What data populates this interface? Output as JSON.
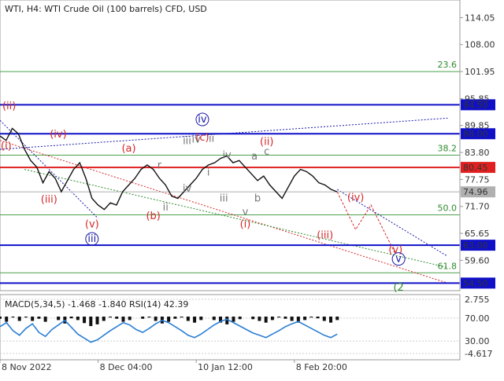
{
  "chart_data": {
    "type": "line",
    "title": "WTI, H4:  WTI Crude Oil (100 barrels) CFD, USD",
    "price_axis": {
      "ticks": [
        114.05,
        108.0,
        101.95,
        95.85,
        89.85,
        83.8,
        77.75,
        71.7,
        65.65,
        59.6
      ],
      "ylim": [
        52.8,
        118.0
      ]
    },
    "time_axis": {
      "labels": [
        "8 Nov 2022",
        "8 Dec 04:00",
        "10 Jan 12:00",
        "8 Feb 20:00"
      ],
      "xlim": [
        0,
        150
      ]
    },
    "price_series": [
      {
        "x": 0,
        "y": 87.5
      },
      {
        "x": 2,
        "y": 86.5
      },
      {
        "x": 4,
        "y": 89.2
      },
      {
        "x": 6,
        "y": 88.0
      },
      {
        "x": 8,
        "y": 84.5
      },
      {
        "x": 10,
        "y": 82.0
      },
      {
        "x": 12,
        "y": 80.5
      },
      {
        "x": 14,
        "y": 77.0
      },
      {
        "x": 16,
        "y": 79.5
      },
      {
        "x": 18,
        "y": 78.0
      },
      {
        "x": 20,
        "y": 75.0
      },
      {
        "x": 22,
        "y": 77.5
      },
      {
        "x": 24,
        "y": 80.0
      },
      {
        "x": 26,
        "y": 81.5
      },
      {
        "x": 28,
        "y": 78.0
      },
      {
        "x": 30,
        "y": 73.5
      },
      {
        "x": 32,
        "y": 72.0
      },
      {
        "x": 34,
        "y": 71.0
      },
      {
        "x": 36,
        "y": 72.5
      },
      {
        "x": 38,
        "y": 72.0
      },
      {
        "x": 40,
        "y": 75.0
      },
      {
        "x": 42,
        "y": 76.5
      },
      {
        "x": 44,
        "y": 78.0
      },
      {
        "x": 46,
        "y": 80.0
      },
      {
        "x": 48,
        "y": 81.0
      },
      {
        "x": 50,
        "y": 80.0
      },
      {
        "x": 52,
        "y": 78.0
      },
      {
        "x": 54,
        "y": 76.5
      },
      {
        "x": 56,
        "y": 74.0
      },
      {
        "x": 58,
        "y": 73.5
      },
      {
        "x": 60,
        "y": 75.0
      },
      {
        "x": 62,
        "y": 76.5
      },
      {
        "x": 64,
        "y": 78.0
      },
      {
        "x": 66,
        "y": 80.0
      },
      {
        "x": 68,
        "y": 81.0
      },
      {
        "x": 70,
        "y": 81.5
      },
      {
        "x": 72,
        "y": 82.5
      },
      {
        "x": 74,
        "y": 83.0
      },
      {
        "x": 76,
        "y": 81.5
      },
      {
        "x": 78,
        "y": 82.0
      },
      {
        "x": 80,
        "y": 80.5
      },
      {
        "x": 82,
        "y": 79.0
      },
      {
        "x": 84,
        "y": 77.5
      },
      {
        "x": 86,
        "y": 78.5
      },
      {
        "x": 88,
        "y": 76.5
      },
      {
        "x": 90,
        "y": 75.0
      },
      {
        "x": 92,
        "y": 73.5
      },
      {
        "x": 94,
        "y": 76.0
      },
      {
        "x": 96,
        "y": 78.5
      },
      {
        "x": 98,
        "y": 80.0
      },
      {
        "x": 100,
        "y": 79.5
      },
      {
        "x": 102,
        "y": 78.5
      },
      {
        "x": 104,
        "y": 77.0
      },
      {
        "x": 106,
        "y": 76.5
      },
      {
        "x": 108,
        "y": 75.5
      },
      {
        "x": 110,
        "y": 74.96
      }
    ],
    "horizontal_levels": [
      {
        "label": "94.50",
        "value": 94.5,
        "color": "#1010c8",
        "style": "solid"
      },
      {
        "label": "88.00",
        "value": 88.0,
        "color": "#1010c8",
        "style": "solid"
      },
      {
        "label": "80.45",
        "value": 80.45,
        "color": "#e02020",
        "style": "solid"
      },
      {
        "label": "74.96",
        "value": 74.96,
        "color": "#b0b0b0",
        "style": "solid"
      },
      {
        "label": "63.00",
        "value": 63.0,
        "color": "#1010c8",
        "style": "solid"
      },
      {
        "label": "54.50",
        "value": 54.5,
        "color": "#1010c8",
        "style": "solid"
      }
    ],
    "fib_levels": [
      {
        "label": "23.6",
        "value": 101.95
      },
      {
        "label": "38.2",
        "value": 83.2
      },
      {
        "label": "50.0",
        "value": 69.8
      },
      {
        "label": "61.8",
        "value": 56.8
      }
    ],
    "wave_labels": [
      {
        "text": "(ii)",
        "x": 3,
        "y": 93.5,
        "color": "red"
      },
      {
        "text": "(i)",
        "x": 2,
        "y": 84.5,
        "color": "red"
      },
      {
        "text": "(iii)",
        "x": 16,
        "y": 72.5,
        "color": "red"
      },
      {
        "text": "(iv)",
        "x": 19,
        "y": 87.2,
        "color": "red"
      },
      {
        "text": "(v)",
        "x": 30,
        "y": 67.0,
        "color": "red"
      },
      {
        "text": "iii",
        "x": 30,
        "y": 63.7,
        "color": "blue"
      },
      {
        "text": "(a)",
        "x": 42,
        "y": 84.0,
        "color": "red"
      },
      {
        "text": "(b)",
        "x": 50,
        "y": 68.8,
        "color": "red"
      },
      {
        "text": "iv",
        "x": 66,
        "y": 90.5,
        "color": "blue"
      },
      {
        "text": "(c)",
        "x": 66,
        "y": 86.5,
        "color": "red"
      },
      {
        "text": "(i)",
        "x": 80,
        "y": 67.0,
        "color": "red"
      },
      {
        "text": "(ii)",
        "x": 87,
        "y": 85.5,
        "color": "red"
      },
      {
        "text": "(iii)",
        "x": 106,
        "y": 64.5,
        "color": "red"
      },
      {
        "text": "(iv)",
        "x": 116,
        "y": 73.0,
        "color": "red"
      },
      {
        "text": "(v)",
        "x": 129,
        "y": 61.3,
        "color": "red"
      },
      {
        "text": "v",
        "x": 130,
        "y": 59.2,
        "color": "blue"
      },
      {
        "text": "(2",
        "x": 130,
        "y": 52.8,
        "color": "green"
      },
      {
        "text": "iii",
        "x": 61,
        "y": 85.7,
        "color": "gray"
      },
      {
        "text": "iv",
        "x": 64,
        "y": 86.0,
        "color": "gray"
      },
      {
        "text": "ii",
        "x": 69,
        "y": 86.2,
        "color": "gray"
      },
      {
        "text": "iv",
        "x": 74,
        "y": 82.5,
        "color": "gray"
      },
      {
        "text": "i",
        "x": 68,
        "y": 78.6,
        "color": "gray"
      },
      {
        "text": "r",
        "x": 52,
        "y": 80.2,
        "color": "gray"
      },
      {
        "text": "iv",
        "x": 61,
        "y": 75.0,
        "color": "gray"
      },
      {
        "text": "iii",
        "x": 73,
        "y": 72.8,
        "color": "gray"
      },
      {
        "text": "ii",
        "x": 54,
        "y": 70.8,
        "color": "gray"
      },
      {
        "text": "a",
        "x": 83,
        "y": 82.2,
        "color": "gray"
      },
      {
        "text": "c",
        "x": 87,
        "y": 83.3,
        "color": "gray"
      },
      {
        "text": "v",
        "x": 80,
        "y": 69.7,
        "color": "gray"
      },
      {
        "text": "b",
        "x": 84,
        "y": 72.8,
        "color": "gray"
      }
    ],
    "indicator": {
      "title": "MACD(5,34,5) -1.468 -1.840 RSI(14) 42.39",
      "ticks": [
        {
          "label": "2.755",
          "v": 2.755
        },
        {
          "label": "70.00",
          "v": 70
        },
        {
          "label": "30.00",
          "v": 30
        },
        {
          "label": "-4.617",
          "v": -4.617
        }
      ],
      "rsi": [
        55,
        62,
        48,
        40,
        52,
        60,
        45,
        38,
        50,
        58,
        66,
        54,
        42,
        35,
        28,
        32,
        40,
        48,
        55,
        62,
        58,
        50,
        45,
        52,
        60,
        66,
        62,
        55,
        48,
        40,
        36,
        42,
        50,
        58,
        64,
        68,
        62,
        56,
        50,
        44,
        40,
        36,
        42,
        48,
        55,
        60,
        64,
        58,
        52,
        46,
        40,
        36,
        42
      ]
    }
  }
}
